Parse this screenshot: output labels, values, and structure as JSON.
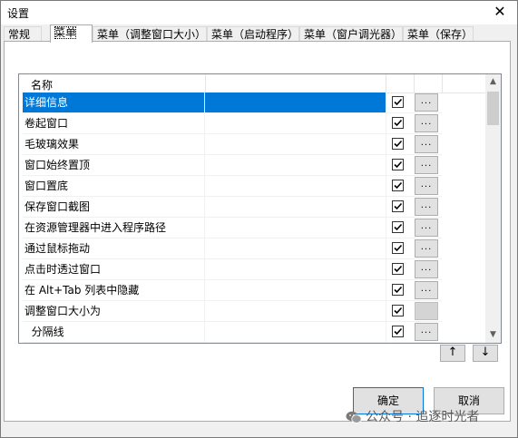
{
  "window": {
    "title": "设置"
  },
  "tabs": [
    {
      "label": "常规"
    },
    {
      "label": "菜单"
    },
    {
      "label": "菜单（调整窗口大小）"
    },
    {
      "label": "菜单（启动程序）"
    },
    {
      "label": "菜单（窗户调光器）"
    },
    {
      "label": "菜单（保存）"
    }
  ],
  "list": {
    "header": "名称",
    "items": [
      {
        "name": "详细信息",
        "checked": true,
        "selected": true
      },
      {
        "name": "卷起窗口",
        "checked": true
      },
      {
        "name": "毛玻璃效果",
        "checked": true
      },
      {
        "name": "窗口始终置顶",
        "checked": true
      },
      {
        "name": "窗口置底",
        "checked": true
      },
      {
        "name": "保存窗口截图",
        "checked": true
      },
      {
        "name": "在资源管理器中进入程序路径",
        "checked": true
      },
      {
        "name": "通过鼠标拖动",
        "checked": true
      },
      {
        "name": "点击时透过窗口",
        "checked": true
      },
      {
        "name": "在 Alt+Tab 列表中隐藏",
        "checked": true
      },
      {
        "name": "调整窗口大小为",
        "checked": true
      },
      {
        "name": "  分隔线",
        "checked": true
      }
    ],
    "ellipsis": "..."
  },
  "buttons": {
    "up": "↑",
    "down": "↓",
    "ok": "确定",
    "cancel": "取消"
  },
  "watermark": "公众号 · 追逐时光者",
  "colors": {
    "selection": "#0078d7",
    "background": "#f0f0f0"
  }
}
